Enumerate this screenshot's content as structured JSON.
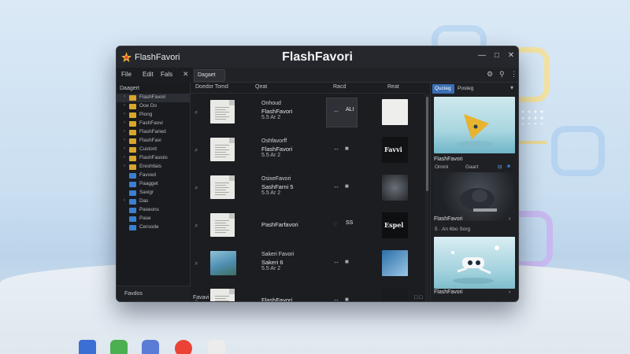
{
  "window": {
    "app_name": "FlashFavori",
    "title": "FlashFavori",
    "controls": {
      "minimize": "—",
      "maximize": "□",
      "close": "✕"
    }
  },
  "menu": [
    "File",
    "Edit",
    "Fals"
  ],
  "menu_close": "✕",
  "toolbar": {
    "active_tab": "Dagaet"
  },
  "sidebar": {
    "root": "Daagert",
    "items": [
      {
        "label": "FlashFavori",
        "color": "#d9a52c",
        "twisty": "›",
        "selected": true
      },
      {
        "label": "Ooe Do",
        "color": "#d9a52c",
        "twisty": "›"
      },
      {
        "label": "Piong",
        "color": "#d9a52c",
        "twisty": "›"
      },
      {
        "label": "FashFaovi",
        "color": "#d9a52c",
        "twisty": "›"
      },
      {
        "label": "FlashFaried",
        "color": "#d9a52c",
        "twisty": "›"
      },
      {
        "label": "FlashFavi",
        "color": "#d9a52c",
        "twisty": "›"
      },
      {
        "label": "Custont",
        "color": "#d9a52c",
        "twisty": "›"
      },
      {
        "label": "FlashFasiols",
        "color": "#d9a52c",
        "twisty": "›"
      },
      {
        "label": "Ereshtlais",
        "color": "#d9a52c",
        "twisty": "›"
      },
      {
        "label": "Favved",
        "color": "#3a7fd0",
        "twisty": ""
      },
      {
        "label": "Paagget",
        "color": "#3a7fd0",
        "twisty": ""
      },
      {
        "label": "Saxigr",
        "color": "#3a7fd0",
        "twisty": ""
      },
      {
        "label": "Das",
        "color": "#3a7fd0",
        "twisty": "›"
      },
      {
        "label": "Paseons",
        "color": "#3a7fd0",
        "twisty": ""
      },
      {
        "label": "Pase",
        "color": "#3a7fd0",
        "twisty": ""
      },
      {
        "label": "Ceroode",
        "color": "#3a7fd0",
        "twisty": ""
      }
    ],
    "footer": "Favdos"
  },
  "columns": [
    "Doedor Tomd",
    "Qeat",
    "Racd",
    "Reat"
  ],
  "rows": [
    {
      "t1": "Onhoud",
      "t2": "FlashFavori",
      "t3": "5.5 Ar 2",
      "kind": "doc",
      "ali": "ALI",
      "selected": true
    },
    {
      "t1": "Oshfavorff",
      "t2": "FlashFavori",
      "t3": "5.5 Ar 2",
      "kind": "doc",
      "ali": ""
    },
    {
      "t1": "OsixeFavori",
      "t2": "SashFarni 5",
      "t3": "5.5 Ar 2",
      "kind": "doc",
      "ali": ""
    },
    {
      "t1": "",
      "t2": "PashFarfavori",
      "t3": "",
      "kind": "doc",
      "ali": "SS"
    },
    {
      "t1": "Sakeri Favori",
      "t2": "Sakeri 6",
      "t3": "5.5 Ar 2",
      "kind": "photo",
      "ali": ""
    },
    {
      "t1": "",
      "t2": "FlashFavori",
      "t3": "5.5 Ar 2",
      "kind": "doc",
      "ali": ""
    }
  ],
  "row_preview_labels": {
    "row2": "Favvi",
    "row4": "Espel"
  },
  "right_panel": {
    "tab_active": "Qucieg",
    "tab_other": "Posteg",
    "captions": [
      "FlashFavori",
      "FlashFavori",
      "FlashFavori"
    ],
    "meta_1": [
      "Onnni",
      "Gaart"
    ],
    "meta_2": "5 · An 6bo Sorg"
  },
  "status": {
    "left": "Favavi",
    "right": "□ □"
  },
  "dock": [
    {
      "name": "launcher-icon",
      "color": "#3b6fd4"
    },
    {
      "name": "files-icon",
      "color": "#4caf50"
    },
    {
      "name": "settings-icon",
      "color": "#5a7bd6"
    },
    {
      "name": "chrome-icon",
      "color": "#ea4335"
    },
    {
      "name": "photos-icon",
      "color": "#ececec"
    }
  ],
  "colors": {
    "window_bg": "#1c1d21",
    "accent": "#3a6fb6",
    "folder": "#d9a52c",
    "folder_blue": "#3a7fd0"
  }
}
